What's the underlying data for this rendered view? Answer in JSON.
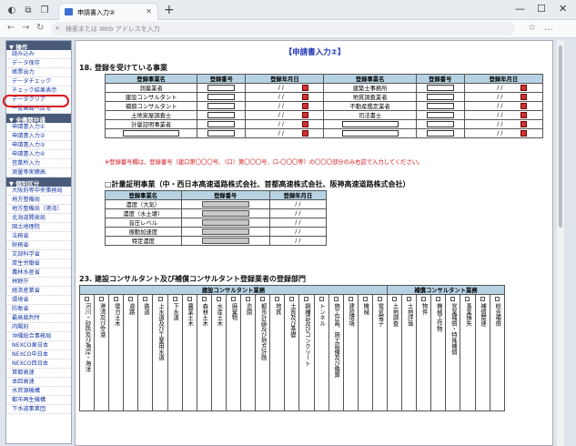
{
  "browser": {
    "tab_title": "申請書入力②",
    "address_placeholder": "検索または Web アドレスを入力"
  },
  "sidebar": {
    "sections": [
      {
        "title": "▼ 操作",
        "items": [
          "読み込み",
          "データ保存",
          "帳票出力",
          "データチェック",
          "チェック結果表示",
          "データクリア",
          "一覧画面へ戻る"
        ]
      },
      {
        "title": "▼ 全機関共通",
        "items": [
          "申請書入力①",
          "申請書入力②",
          "申請書入力③",
          "申請書入力④",
          "営業所入力",
          "測量等実績高"
        ]
      },
      {
        "title": "▼ 個別区分",
        "items": [
          "大阪府等中央事務局",
          "地方整備局",
          "地方整備局（港湾）",
          "北海道開発局",
          "国土地理院",
          "法務省",
          "財務省",
          "文部科学省",
          "厚生労働省",
          "農林水産省",
          "林野庁",
          "経済産業省",
          "環境省",
          "防衛省",
          "最高裁判所",
          "内閣府",
          "沖縄総合事務局",
          "NEXCO東日本",
          "NEXCO中日本",
          "NEXCO西日本",
          "首都高速",
          "本四高速",
          "水資源機構",
          "都市再生機構",
          "下水道事業団"
        ]
      }
    ]
  },
  "page": {
    "title": "【申請書入力②】"
  },
  "sec18": {
    "heading": "18. 登録を受けている事業",
    "col_name": "登録事業名",
    "col_num": "登録番号",
    "col_date": "登録年月日",
    "date_placeholder": "/ /",
    "left": [
      "測量業者",
      "建設コンサルタント",
      "補償コンサルタント",
      "土地家屋調査士",
      "計量証明事業者",
      ""
    ],
    "right": [
      "建築士事務所",
      "地質調査業者",
      "不動産鑑定業者",
      "司法書士",
      "",
      ""
    ],
    "note": "※登録番号欄は、登録番号（建口第〇〇〇号、（口）第〇〇〇号、口-〇〇〇等）の〇〇〇部分のみ右詰で入力してください。"
  },
  "measure": {
    "heading": "□計量証明事業（中・西日本高速道路株式会社、首都高速株式会社、阪神高速道路株式会社）",
    "col_name": "登録事業名",
    "col_num": "登録番号",
    "col_date": "登録年月日",
    "rows": [
      "濃度（大気）",
      "濃度（水土壌）",
      "音圧レベル",
      "振動加速度",
      "特定濃度"
    ],
    "date": "/ /"
  },
  "sec23": {
    "heading": "23. 建設コンサルタント及び補償コンサルタント登録業者の登録部門",
    "group1": "建設コンサルタント業務",
    "group2": "補償コンサルタント業務",
    "construction": [
      "河川・砂防及び海岸・海洋",
      "港湾及び空港",
      "電力土木",
      "道路",
      "鉄道",
      "上水道及び工業用水道",
      "下水道",
      "農業土木",
      "森林土木",
      "水産土木",
      "廃棄物",
      "造園",
      "都市計画及び地方計画",
      "地質",
      "土質及び基礎",
      "鋼構造及びコンクリート",
      "トンネル",
      "施工計画、施工設備及び積算",
      "建設環境",
      "機械",
      "電気電子"
    ],
    "compensation": [
      "土地調査",
      "土地評価",
      "物件",
      "機械工作物",
      "営業補償・特殊補償",
      "事業損失",
      "補償関連",
      "総合補償"
    ]
  }
}
